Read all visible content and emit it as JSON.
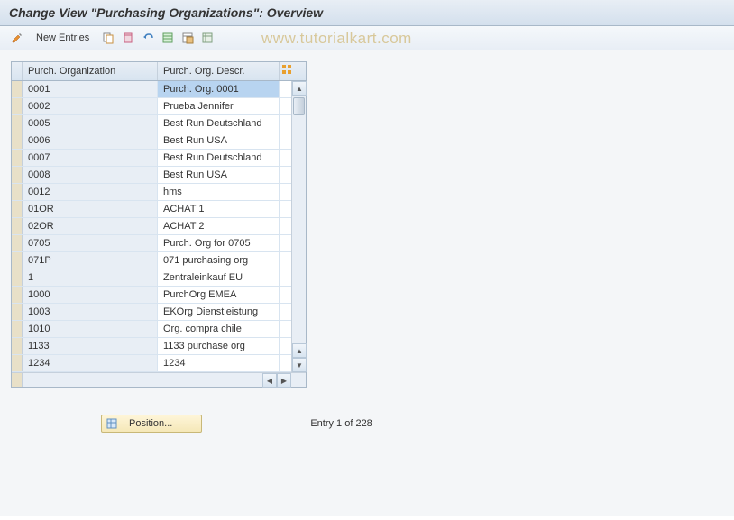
{
  "header": {
    "title": "Change View \"Purchasing Organizations\": Overview"
  },
  "toolbar": {
    "new_entries": "New Entries"
  },
  "watermark": "www.tutorialkart.com",
  "table": {
    "col1_header": "Purch. Organization",
    "col2_header": "Purch. Org. Descr.",
    "rows": [
      {
        "org": "0001",
        "descr": "Purch. Org. 0001",
        "selected": true
      },
      {
        "org": "0002",
        "descr": "Prueba Jennifer"
      },
      {
        "org": "0005",
        "descr": "Best Run Deutschland"
      },
      {
        "org": "0006",
        "descr": "Best Run USA"
      },
      {
        "org": "0007",
        "descr": "Best Run Deutschland"
      },
      {
        "org": "0008",
        "descr": "Best Run USA"
      },
      {
        "org": "0012",
        "descr": "hms"
      },
      {
        "org": "01OR",
        "descr": "ACHAT 1"
      },
      {
        "org": "02OR",
        "descr": "ACHAT 2"
      },
      {
        "org": "0705",
        "descr": "Purch. Org for 0705"
      },
      {
        "org": "071P",
        "descr": "071 purchasing org"
      },
      {
        "org": "1",
        "descr": "Zentraleinkauf EU"
      },
      {
        "org": "1000",
        "descr": "PurchOrg EMEA"
      },
      {
        "org": "1003",
        "descr": "EKOrg Dienstleistung"
      },
      {
        "org": "1010",
        "descr": "Org. compra chile"
      },
      {
        "org": "1133",
        "descr": "1133 purchase org"
      },
      {
        "org": "1234",
        "descr": "1234"
      }
    ]
  },
  "footer": {
    "position_btn": "Position...",
    "entry_text": "Entry 1 of 228"
  }
}
